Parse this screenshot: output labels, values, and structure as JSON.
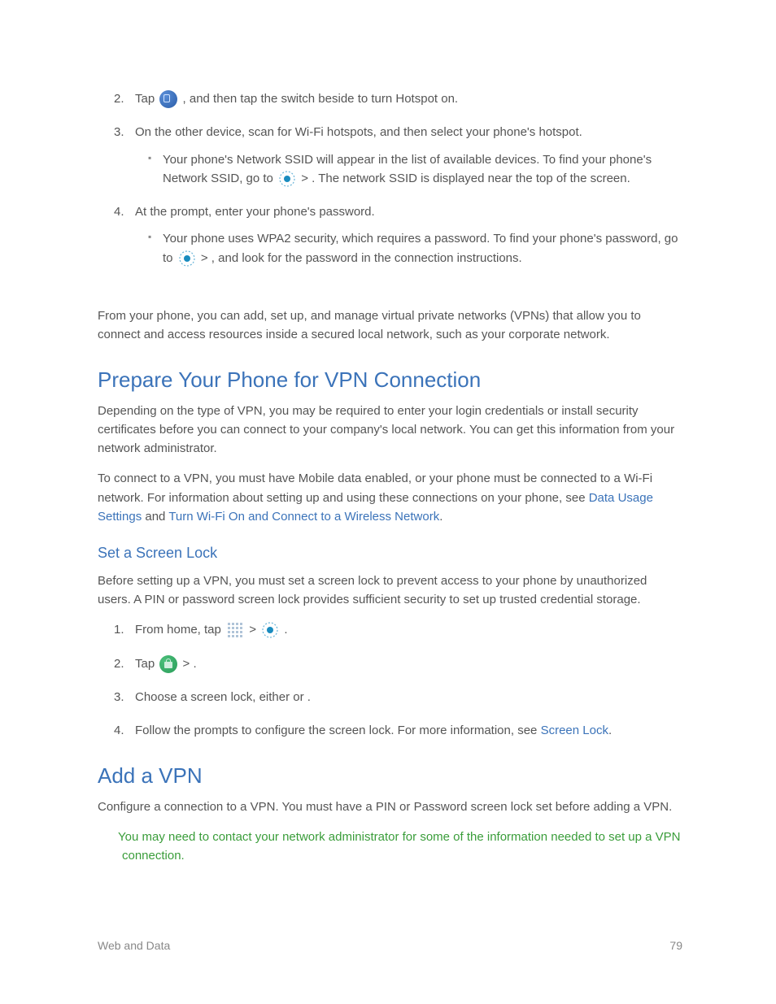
{
  "steps_a": {
    "s2": {
      "num": "2.",
      "t1": "Tap ",
      "t2": ", and then tap the ",
      "t3": " switch beside ",
      "t4": " to turn Hotspot on."
    },
    "s3": {
      "num": "3.",
      "t1": "On the other device, scan for Wi-Fi hotspots, and then select your phone's hotspot.",
      "b1a": "Your phone's Network SSID will appear in the list of available devices. To find your phone's Network SSID, go to ",
      "b1b": " > ",
      "b1c": ". The network SSID is displayed near the top of the screen."
    },
    "s4": {
      "num": "4.",
      "t1": "At the prompt, enter your phone's password.",
      "b1a": "Your phone uses WPA2 security, which requires a password. To find your phone's password, go to ",
      "b1b": " > ",
      "b1c": ", and look for the password in the connection instructions."
    }
  },
  "vpn_intro": "From your phone, you can add, set up, and manage virtual private networks (VPNs) that allow you to connect and access resources inside a secured local network, such as your corporate network.",
  "h2_prepare": "Prepare Your Phone for VPN Connection",
  "prepare_p1": "Depending on the type of VPN, you may be required to enter your login credentials or install security certificates before you can connect to your company's local network. You can get this information from your network administrator.",
  "prepare_p2a": "To connect to a VPN, you must have Mobile data enabled, or your phone must be connected to a Wi-Fi network. For information about setting up and using these connections on your phone, see ",
  "link_data_usage": "Data Usage Settings",
  "prepare_p2b": " and ",
  "link_wifi": "Turn Wi-Fi On and Connect to a Wireless Network",
  "prepare_p2c": ".",
  "h3_screenlock": "Set a Screen Lock",
  "screenlock_p1": "Before setting up a VPN, you must set a screen lock to prevent access to your phone by unauthorized users. A PIN or password screen lock provides sufficient security to set up trusted credential storage.",
  "steps_b": {
    "s1": {
      "num": "1.",
      "t1": "From home, tap ",
      "t2": " > ",
      "t3": "."
    },
    "s2": {
      "num": "2.",
      "t1": "Tap ",
      "t2": " > ",
      "t3": "."
    },
    "s3": {
      "num": "3.",
      "t1": "Choose a screen lock, either ",
      "t2": " or ",
      "t3": "."
    },
    "s4": {
      "num": "4.",
      "t1": "Follow the prompts to configure the screen lock. For more information, see ",
      "link": "Screen Lock",
      "t2": "."
    }
  },
  "h2_addvpn": "Add a VPN",
  "addvpn_p1": "Configure a connection to a VPN. You must have a PIN or Password screen lock set before adding a VPN.",
  "note": "You may need to contact your network administrator for some of the information needed to set up a VPN connection.",
  "footer_left": "Web and Data",
  "footer_right": "79"
}
